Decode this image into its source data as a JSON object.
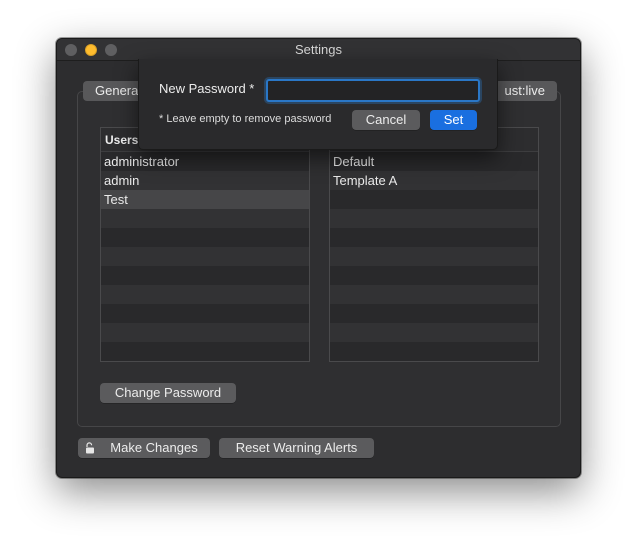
{
  "window": {
    "title": "Settings"
  },
  "tabs": {
    "general_label": "Genera",
    "trust_label": "ust:live"
  },
  "users_list": {
    "header": "Users",
    "rows": [
      "administrator",
      "admin",
      "Test",
      "",
      "",
      "",
      "",
      "",
      "",
      "",
      ""
    ],
    "selected": "Test"
  },
  "templates_list": {
    "header": "",
    "rows": [
      "Default",
      "Template A",
      "",
      "",
      "",
      "",
      "",
      "",
      "",
      "",
      ""
    ]
  },
  "buttons": {
    "change_password": "Change Password",
    "make_changes": "Make Changes",
    "reset_warning_alerts": "Reset Warning Alerts"
  },
  "sheet": {
    "label": "New Password *",
    "input_value": "",
    "note": "* Leave empty to remove password",
    "cancel_label": "Cancel",
    "set_label": "Set"
  },
  "colors": {
    "accent": "#1a6fe0",
    "focus_ring": "#2a77c7",
    "minimize": "#febc2e"
  },
  "icons": {
    "lock": "unlocked-padlock"
  }
}
